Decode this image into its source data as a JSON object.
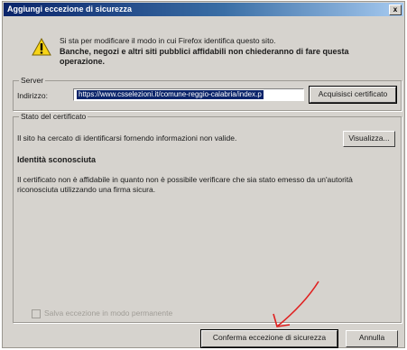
{
  "window": {
    "title": "Aggiungi eccezione di sicurezza",
    "close_glyph": "x"
  },
  "intro": {
    "icon": "warning-icon",
    "line1": "Si sta per modificare il modo in cui Firefox identifica questo sito.",
    "line2": "Banche, negozi e altri siti pubblici affidabili non chiederanno di fare questa operazione."
  },
  "server": {
    "legend": "Server",
    "address_label": "Indirizzo:",
    "address_value": "https://www.csselezioni.it/comune-reggio-calabria/index.p",
    "get_certificate_label": "Acquisisci certificato"
  },
  "certificate_status": {
    "legend": "Stato del certificato",
    "status_text": "Il sito ha cercato di identificarsi fornendo informazioni non valide.",
    "view_button_label": "Visualizza...",
    "identity_heading": "Identità sconosciuta",
    "description": "Il certificato non è affidabile in quanto non è possibile verificare che sia stato emesso da un'autorità riconosciuta utilizzando una firma sicura.",
    "permanent_checkbox_label": "Salva eccezione in modo permanente",
    "permanent_checkbox_checked": false
  },
  "footer": {
    "confirm_label": "Conferma eccezione di sicurezza",
    "cancel_label": "Annulla"
  },
  "colors": {
    "title_start": "#0a246a",
    "title_end": "#a6caf0",
    "dialog_bg": "#d6d3ce",
    "selection_bg": "#0a246a",
    "annotation_arrow": "#e02020"
  }
}
